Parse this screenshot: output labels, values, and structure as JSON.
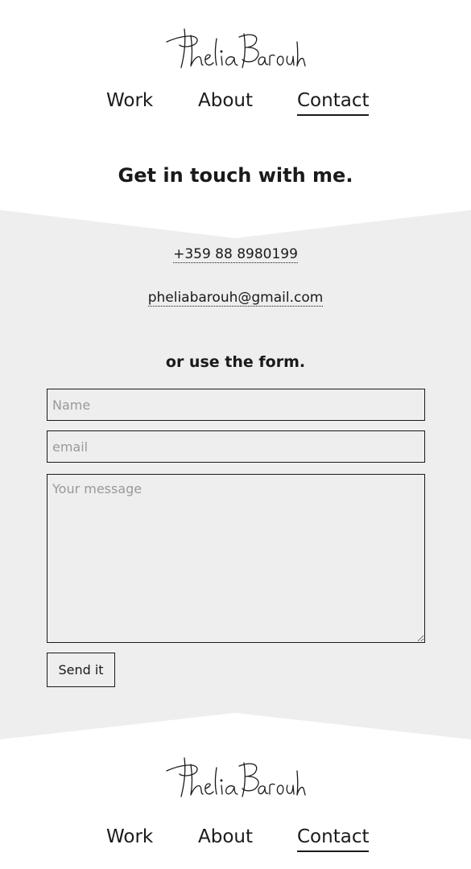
{
  "header": {
    "logo_alt": "Phelia Barouh",
    "nav": {
      "work": "Work",
      "about": "About",
      "contact": "Contact"
    }
  },
  "main": {
    "heading": "Get in touch with me.",
    "phone": "+359 88 8980199",
    "email": "pheliabarouh@gmail.com",
    "form_heading": "or use the form.",
    "form": {
      "name_placeholder": "Name",
      "email_placeholder": "email",
      "message_placeholder": "Your message",
      "submit_label": "Send it"
    }
  },
  "footer": {
    "logo_alt": "Phelia Barouh",
    "nav": {
      "work": "Work",
      "about": "About",
      "contact": "Contact"
    }
  },
  "colors": {
    "band": "#eeeeee",
    "text": "#1a1a1a",
    "placeholder": "#999999"
  }
}
